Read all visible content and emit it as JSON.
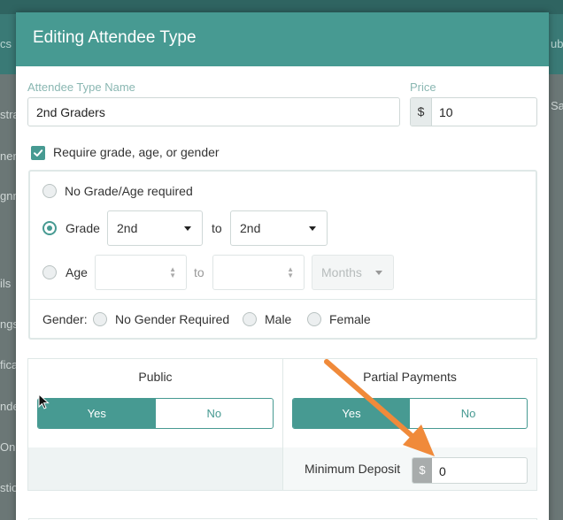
{
  "background": {
    "fragments": [
      "cs",
      "stra",
      "nen",
      "gnm",
      "ils",
      "ngs",
      "fica",
      "nde",
      "Onl",
      "stio",
      "ublic",
      "Sapa"
    ]
  },
  "modal": {
    "title": "Editing Attendee Type"
  },
  "form": {
    "name_label": "Attendee Type Name",
    "name_value": "2nd Graders",
    "price_label": "Price",
    "currency_symbol": "$",
    "price_value": "10",
    "require_checkbox_label": "Require grade, age, or gender",
    "require_checked": true
  },
  "requirements": {
    "none_label": "No Grade/Age required",
    "grade_label": "Grade",
    "grade_from": "2nd",
    "grade_to": "2nd",
    "to_label": "to",
    "age_label": "Age",
    "age_unit": "Months",
    "selected_option": "Grade",
    "gender_label": "Gender:",
    "gender_options": [
      "No Gender Required",
      "Male",
      "Female"
    ]
  },
  "payments": {
    "public_label": "Public",
    "partial_label": "Partial Payments",
    "yes_label": "Yes",
    "no_label": "No",
    "public_value": "Yes",
    "partial_value": "Yes",
    "min_deposit_label": "Minimum Deposit",
    "min_deposit_currency": "$",
    "min_deposit_value": "0"
  },
  "colors": {
    "accent": "#479a92",
    "annotation_arrow": "#f08a3a"
  }
}
